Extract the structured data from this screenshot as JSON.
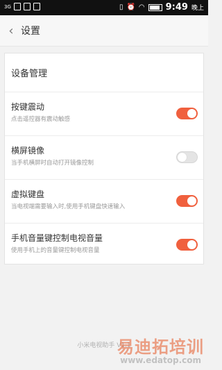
{
  "status_bar": {
    "network": "3G",
    "time": "9:49",
    "ampm": "晚上"
  },
  "header": {
    "title": "设置"
  },
  "settings": {
    "section_title": "设备管理",
    "items": [
      {
        "title": "按键震动",
        "subtitle": "点击遥控器有震动触感",
        "enabled": true
      },
      {
        "title": "横屏镜像",
        "subtitle": "当手机横屏时自动打开镜像控制",
        "enabled": false
      },
      {
        "title": "虚拟键盘",
        "subtitle": "当电视端需要输入时,使用手机键盘快速输入",
        "enabled": true
      },
      {
        "title": "手机音量键控制电视音量",
        "subtitle": "使用手机上的音量键控制电视音量",
        "enabled": true
      }
    ]
  },
  "footer": {
    "text": "小米电视助手 V1.1"
  },
  "watermark": {
    "text": "易迪拓培训",
    "url": "www.edatop.com"
  },
  "colors": {
    "accent": "#f0603e",
    "toggle_off": "#e4e4e4"
  }
}
